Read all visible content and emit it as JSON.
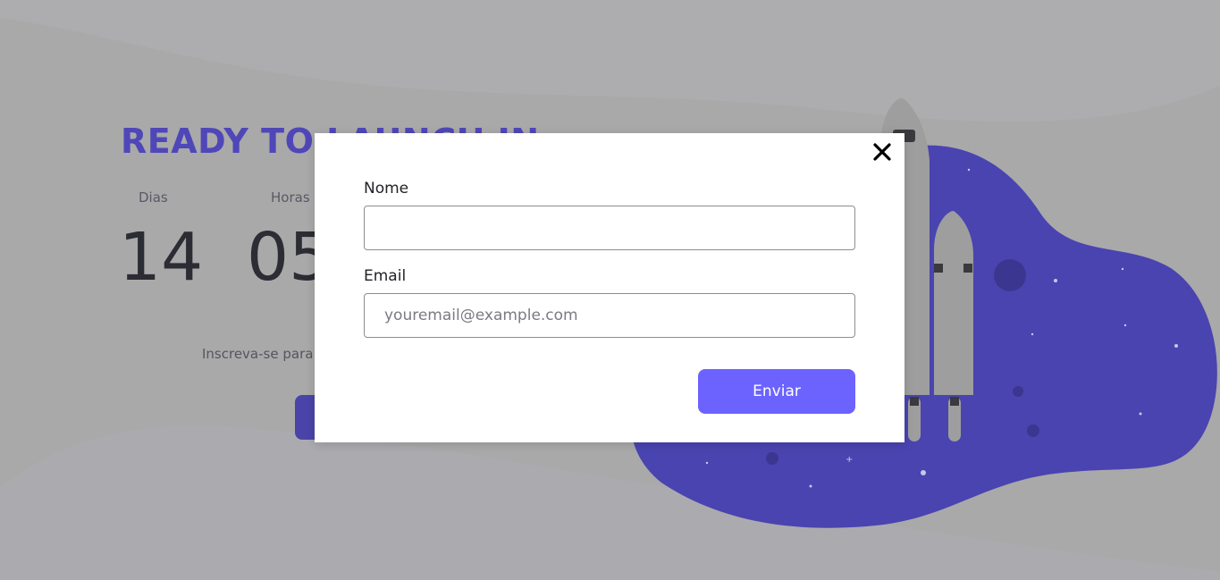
{
  "hero": {
    "headline": "READY TO LAUNCH IN",
    "countdown": [
      {
        "label": "Dias",
        "value": "14"
      },
      {
        "label": "Horas",
        "value": "05"
      }
    ],
    "subscribe_text": "Inscreva-se para"
  },
  "modal": {
    "name_label": "Nome",
    "name_value": "",
    "email_label": "Email",
    "email_placeholder": "youremail@example.com",
    "submit_label": "Enviar"
  },
  "colors": {
    "accent": "#6c63ff",
    "headline": "#4f47b8",
    "blob": "#4a44b0",
    "overlay_bg": "#a9a9a9"
  }
}
